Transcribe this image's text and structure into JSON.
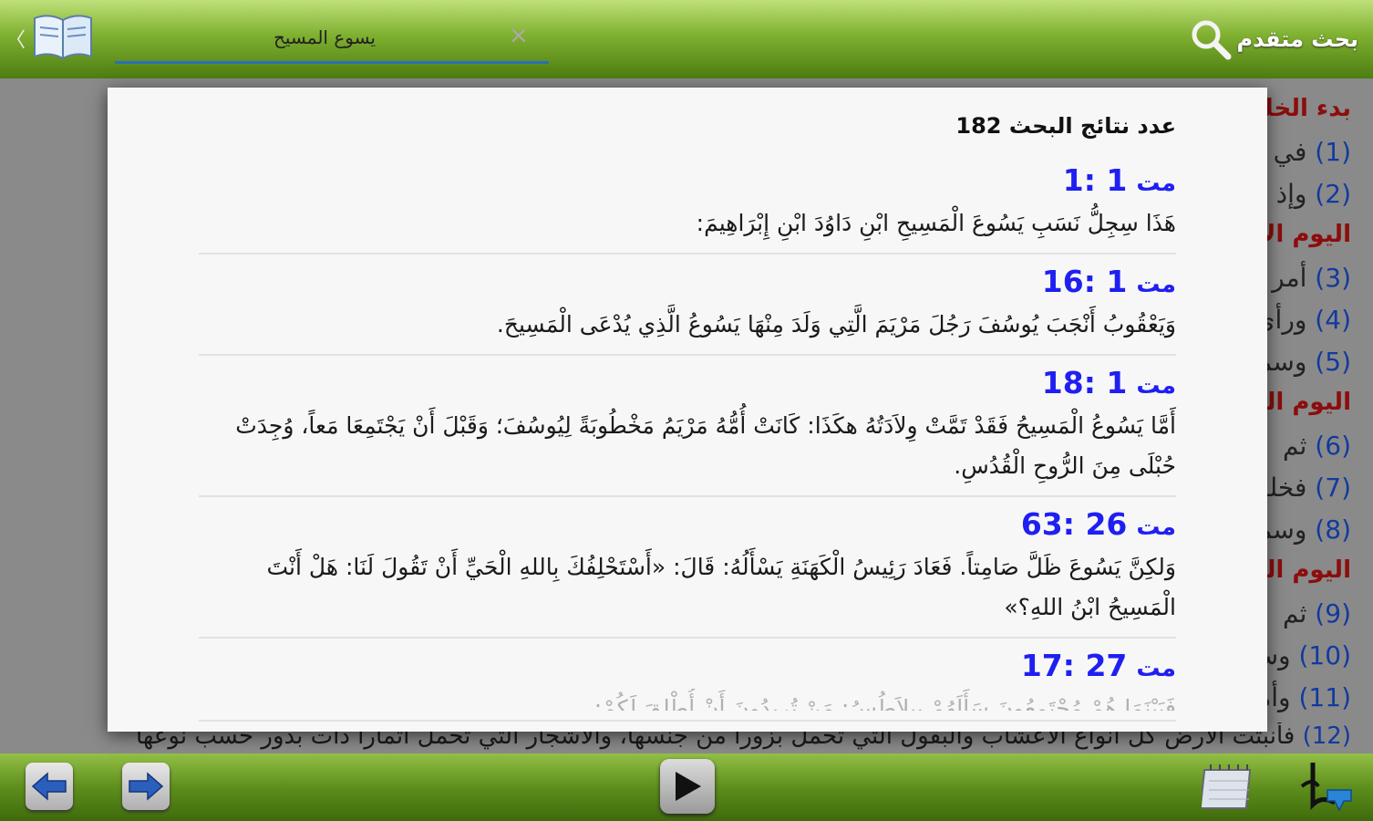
{
  "topbar": {
    "advanced_search_label": "بحث متقدم",
    "search_value": "يسوع المسيح",
    "clear_symbol": "×",
    "chevron_symbol": "〈"
  },
  "background": {
    "heading1": "بدء الخليقة",
    "lines": [
      {
        "num": "(1)",
        "text": "في"
      },
      {
        "num": "(2)",
        "text": "وإذ"
      },
      {
        "num": "(3)",
        "text": "أمر"
      },
      {
        "num": "(4)",
        "text": "ورأى"
      },
      {
        "num": "(5)",
        "text": "وسمى"
      },
      {
        "num": "(6)",
        "text": "ثم"
      },
      {
        "num": "(7)",
        "text": "فخلق"
      },
      {
        "num": "(8)",
        "text": "وسمى"
      },
      {
        "num": "(9)",
        "text": "ثم"
      },
      {
        "num": "(10)",
        "text": "وسمى"
      },
      {
        "num": "(11)",
        "text": "وأمر"
      }
    ],
    "heading2": "اليوم الأول",
    "heading3": "اليوم الثاني",
    "heading4": "اليوم الثالث",
    "last_line_num": "(12)",
    "last_line_text": "فأنبتت الأرض كل أنواع الأعشاب والبقول التي تحمل بزوراً من جنسها، والأشجار التي تحمل أثماراً ذات بذور حسب نوعها"
  },
  "dialog": {
    "count_label": "عدد نتائج البحث",
    "count_value": "182",
    "results": [
      {
        "book": "مت",
        "ref": "1: 1",
        "text": "هَذَا سِجِلُّ نَسَبِ يَسُوعَ الْمَسِيحِ ابْنِ دَاوُدَ ابْنِ إِبْرَاهِيمَ:"
      },
      {
        "book": "مت",
        "ref": "16: 1",
        "text": "وَيَعْقُوبُ أَنْجَبَ يُوسُفَ رَجُلَ مَرْيَمَ الَّتِي وَلَدَ مِنْهَا يَسُوعُ الَّذِي يُدْعَى الْمَسِيحَ."
      },
      {
        "book": "مت",
        "ref": "18: 1",
        "text": "أَمَّا يَسُوعُ الْمَسِيحُ فَقَدْ تَمَّتْ وِلاَدَتُهُ هكَذَا: كَانَتْ أُمُّهُ مَرْيَمُ مَخْطُوبَةً لِيُوسُفَ؛ وَقَبْلَ أَنْ يَجْتَمِعَا مَعاً، وُجِدَتْ حُبْلَى مِنَ الرُّوحِ الْقُدُسِ."
      },
      {
        "book": "مت",
        "ref": "63: 26",
        "text": "وَلكِنَّ يَسُوعَ ظَلَّ صَامِتاً. فَعَادَ رَئِيسُ الْكَهَنَةِ يَسْأَلُهُ: قَالَ: «أَسْتَحْلِفُكَ بِاللهِ الْحَيِّ أَنْ تَقُولَ لَنَا: هَلْ أَنْتَ الْمَسِيحُ ابْنُ اللهِ؟»"
      },
      {
        "book": "مت",
        "ref": "17: 27",
        "text": "فَبَيْنَمَا هُمْ مُجْتَمِعُونَ سَأَلَهُمْ بِيلاَطُسُ: مَنْ تُرِيدُونَ أَنْ أُطْلِقَ لَكُمْ:"
      }
    ]
  },
  "bottombar": {
    "back_label": "السابق",
    "forward_label": "التالي",
    "play_label": "تشغيل"
  },
  "colors": {
    "bar_green": "#6a9b22",
    "ref_blue": "#1f1ff2",
    "heading_red": "#8c0d0d",
    "underline_blue": "#2a6fb5"
  }
}
